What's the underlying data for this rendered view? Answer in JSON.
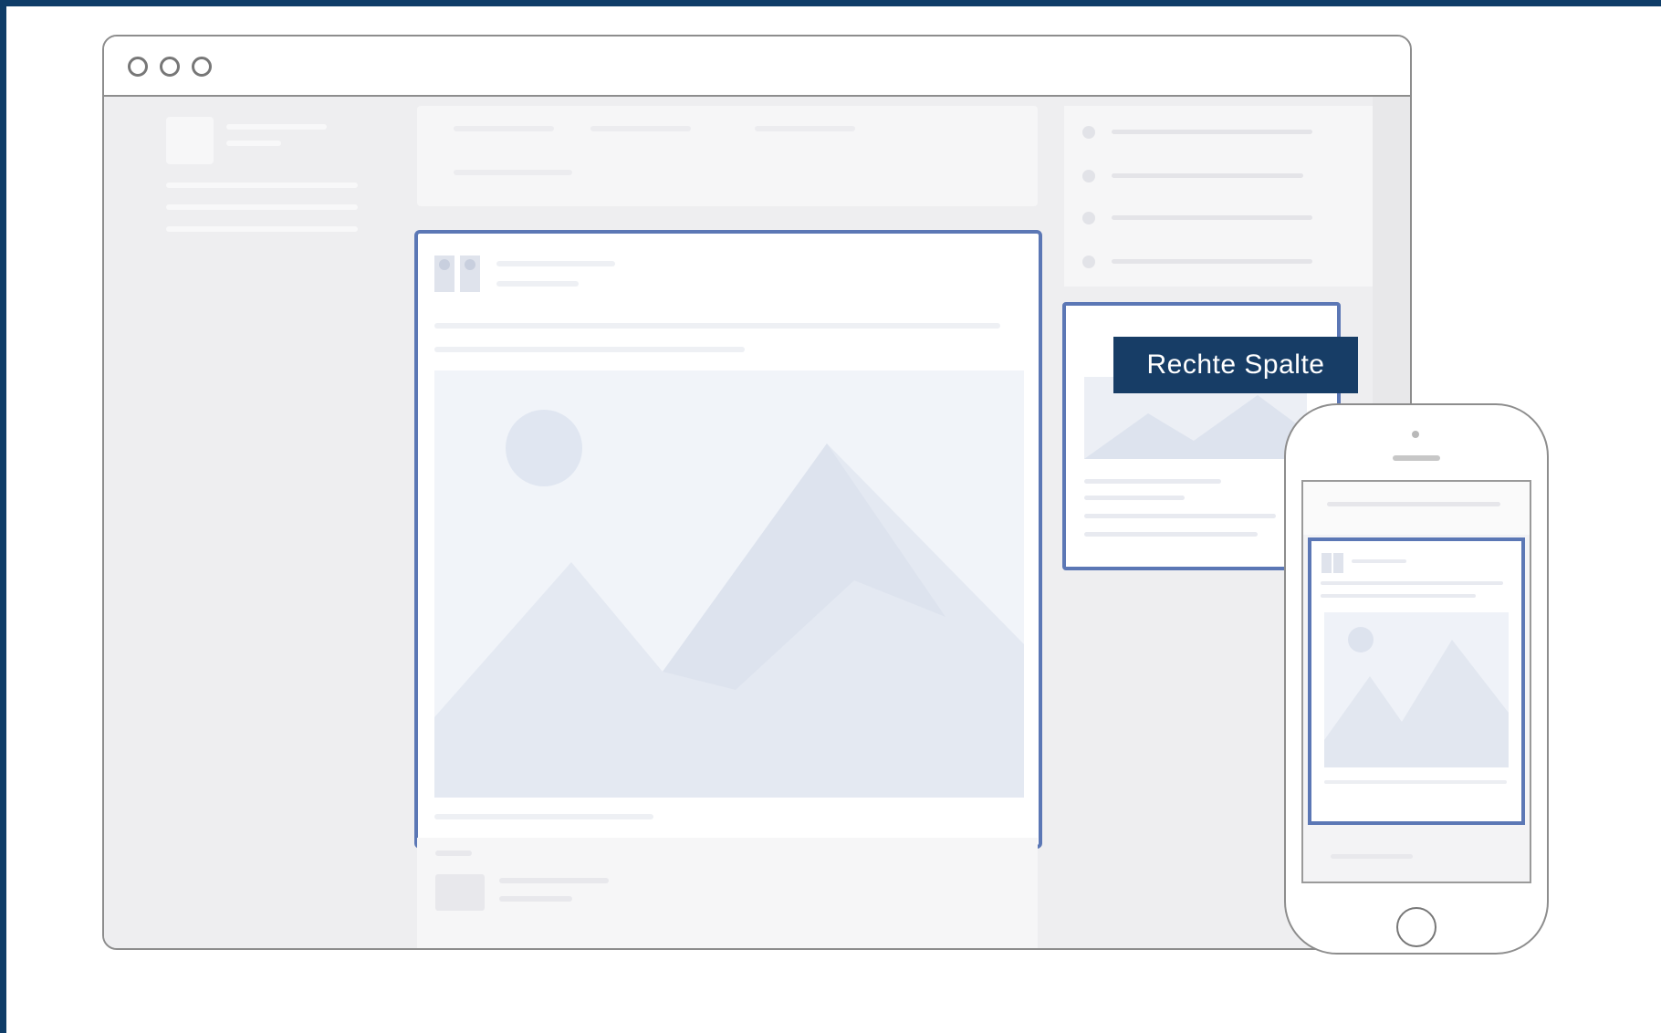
{
  "labels": {
    "right_column": "Rechte Spalte"
  },
  "colors": {
    "frame_border": "#0f3d68",
    "highlight_border": "#5b77b5",
    "label_background": "#173d66",
    "label_text": "#ffffff",
    "device_outline": "#8d8d8d"
  },
  "icons": {
    "window_controls": [
      "window-dot-icon",
      "window-dot-icon",
      "window-dot-icon"
    ],
    "post_avatar": "user-avatar-icon",
    "image_placeholder": "mountain-image-icon",
    "phone_home_button": "home-button-icon"
  }
}
